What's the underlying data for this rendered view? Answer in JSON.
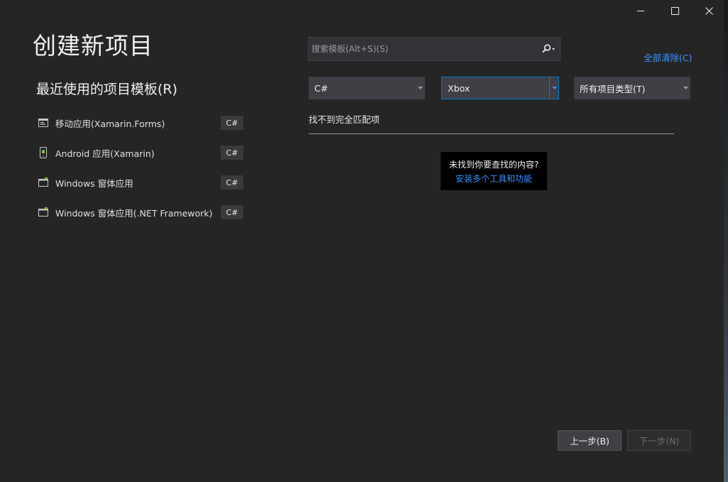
{
  "window": {
    "controls": {
      "minimize": "minimize-icon",
      "maximize": "maximize-icon",
      "close": "close-icon"
    }
  },
  "page": {
    "title": "创建新项目"
  },
  "recent": {
    "title": "最近使用的项目模板(R)",
    "items": [
      {
        "label": "移动应用(Xamarin.Forms)",
        "lang": "C#",
        "icon": "mobile-app-icon"
      },
      {
        "label": "Android 应用(Xamarin)",
        "lang": "C#",
        "icon": "android-app-icon"
      },
      {
        "label": "Windows 窗体应用",
        "lang": "C#",
        "icon": "windows-form-icon"
      },
      {
        "label": "Windows 窗体应用(.NET Framework)",
        "lang": "C#",
        "icon": "windows-form-icon"
      }
    ]
  },
  "search": {
    "placeholder": "搜索模板(Alt+S)(S)",
    "value": ""
  },
  "filters": {
    "clear_all": "全部清除(C)",
    "language": "C#",
    "platform": "Xbox",
    "project_type": "所有项目类型(T)"
  },
  "results": {
    "no_match": "找不到完全匹配项",
    "not_found_question": "未找到你要查找的内容?",
    "install_link": "安装多个工具和功能"
  },
  "footer": {
    "back_label": "上一步(B)",
    "next_label": "下一步(N)"
  },
  "colors": {
    "background": "#252526",
    "accent": "#007acc",
    "link": "#3794ff"
  }
}
